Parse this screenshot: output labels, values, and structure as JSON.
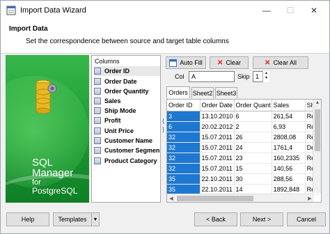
{
  "window": {
    "title": "Import Data Wizard",
    "minimize": "—",
    "maximize": "☐",
    "close": "✕"
  },
  "header": {
    "title": "Import Data",
    "subtitle": "Set the correspondence between source and target table columns"
  },
  "banner": {
    "line1": "SQL",
    "line2": "Manager",
    "line3": "for",
    "line4": "PostgreSQL"
  },
  "columns": {
    "header": "Columns",
    "selected_index": 0,
    "items": [
      "Order ID",
      "Order Date",
      "Order Quantity",
      "Sales",
      "Ship Mode",
      "Profit",
      "Unit Price",
      "Customer Name",
      "Customer Segmen",
      "Product Category"
    ]
  },
  "splitter": {
    "left_arrow": "⟨",
    "right_arrow": "⟩"
  },
  "toolbar": {
    "autofill_label": "Auto Fill",
    "clear_label": "Clear",
    "clearall_label": "Clear All"
  },
  "fields": {
    "col_label": "Col",
    "col_value": "A",
    "skip_label": "Skip",
    "skip_value": "1"
  },
  "tabs": [
    {
      "label": "Orders",
      "active": true
    },
    {
      "label": "Sheet2",
      "active": false
    },
    {
      "label": "Sheet3",
      "active": false
    }
  ],
  "grid": {
    "columns": [
      "Order ID",
      "Order Date",
      "Order Quant",
      "Sales",
      "Shi"
    ],
    "rows": [
      [
        "3",
        "13.10.2010",
        "6",
        "261,54",
        "Re"
      ],
      [
        "6",
        "20.02.2012",
        "2",
        "6,93",
        "Re"
      ],
      [
        "32",
        "15.07.2011",
        "26",
        "2808,08",
        "Re"
      ],
      [
        "32",
        "15.07.2011",
        "24",
        "1761,4",
        "De"
      ],
      [
        "32",
        "15.07.2011",
        "23",
        "160,2335",
        "Re"
      ],
      [
        "32",
        "15.07.2011",
        "15",
        "140,56",
        "Re"
      ],
      [
        "35",
        "22.10.2011",
        "30",
        "288,56",
        "Re"
      ],
      [
        "35",
        "22.10.2011",
        "14",
        "1892,848",
        "Re"
      ]
    ]
  },
  "footer": {
    "help_label": "Help",
    "templates_label": "Templates",
    "back_label": "< Back",
    "next_label": "Next >",
    "cancel_label": "Cancel"
  }
}
